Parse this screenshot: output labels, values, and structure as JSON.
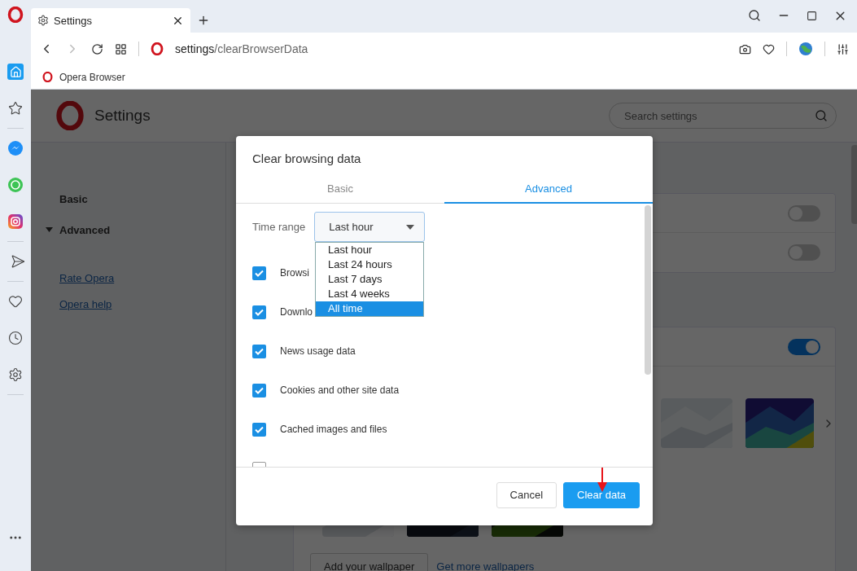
{
  "browser": {
    "tab": {
      "title": "Settings"
    },
    "address": {
      "host": "settings",
      "path": "/clearBrowserData"
    },
    "bookmarks": [
      {
        "label": "Opera Browser"
      }
    ]
  },
  "sidebar": {
    "groups": [
      [
        {
          "kind": "home",
          "selected": true
        },
        {
          "kind": "star",
          "selected": false
        }
      ],
      [
        {
          "kind": "messenger",
          "selected": false
        },
        {
          "kind": "whatsapp",
          "selected": false
        },
        {
          "kind": "instagram",
          "selected": false
        }
      ],
      [
        {
          "kind": "send",
          "selected": false
        }
      ],
      [
        {
          "kind": "heart",
          "selected": false
        },
        {
          "kind": "history",
          "selected": false
        },
        {
          "kind": "settings",
          "selected": false
        }
      ]
    ]
  },
  "settings_page": {
    "title": "Settings",
    "search": {
      "placeholder": "Search settings"
    },
    "nav": [
      {
        "label": "Basic",
        "kind": "section"
      },
      {
        "label": "Advanced",
        "kind": "group",
        "expanded": true
      }
    ],
    "links": [
      "Rate Opera",
      "Opera help"
    ],
    "toggles": [
      {
        "on": false
      },
      {
        "on": false
      }
    ],
    "wallpapers": {
      "toggle": {
        "on": true
      },
      "buttons": {
        "add": "Add your wallpaper",
        "more": "Get more wallpapers"
      }
    }
  },
  "dialog": {
    "title": "Clear browsing data",
    "tabs": [
      {
        "label": "Basic",
        "selected": false
      },
      {
        "label": "Advanced",
        "selected": true
      }
    ],
    "time_range": {
      "label": "Time range",
      "value": "Last hour",
      "options": [
        {
          "label": "Last hour",
          "highlighted": false
        },
        {
          "label": "Last 24 hours",
          "highlighted": false
        },
        {
          "label": "Last 7 days",
          "highlighted": false
        },
        {
          "label": "Last 4 weeks",
          "highlighted": false
        },
        {
          "label": "All time",
          "highlighted": true
        }
      ]
    },
    "items": [
      {
        "label": "Browsi",
        "checked": true
      },
      {
        "label": "Downlo",
        "checked": true
      },
      {
        "label": "News usage data",
        "checked": true
      },
      {
        "label": "Cookies and other site data",
        "checked": true
      },
      {
        "label": "Cached images and files",
        "checked": true
      },
      {
        "checked": false
      }
    ],
    "buttons": [
      {
        "label": "Cancel",
        "kind": "secondary"
      },
      {
        "label": "Clear data",
        "kind": "primary"
      }
    ]
  }
}
